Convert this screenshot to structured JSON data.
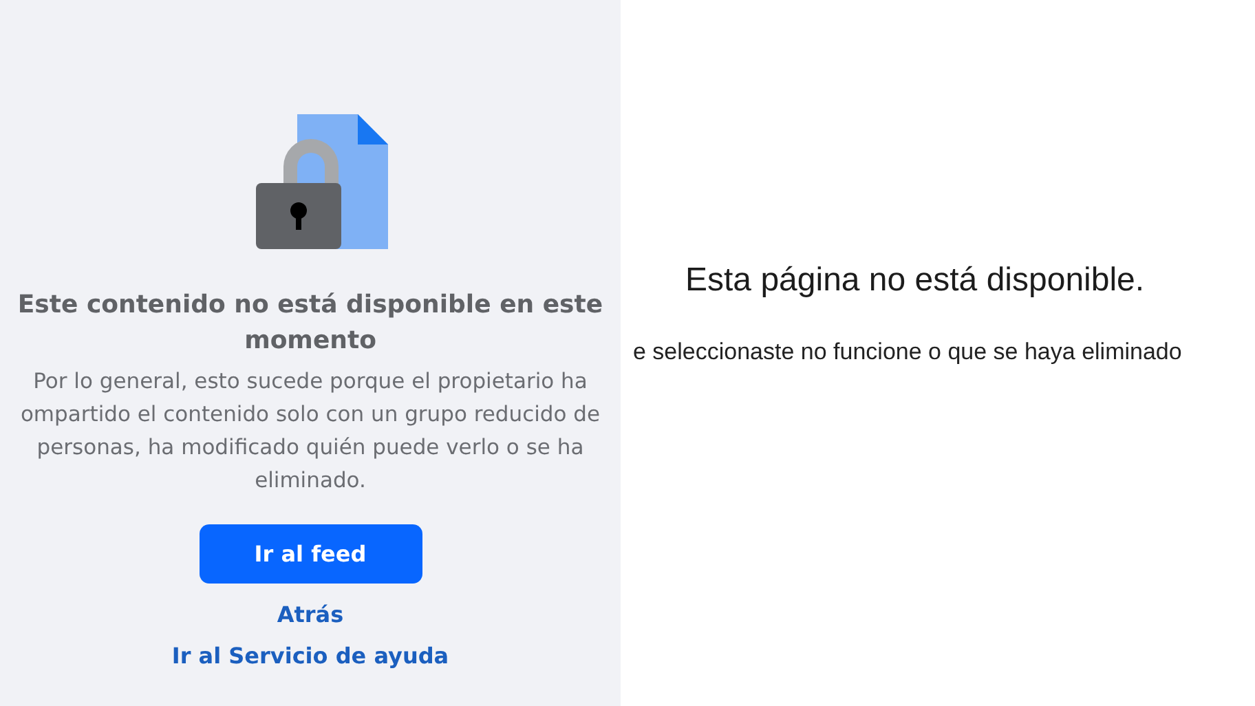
{
  "left_page": {
    "heading": "Este contenido no está disponible en este momento",
    "paragraph_lines": [
      "Por lo general, esto sucede porque el propietario ha",
      "ompartido el contenido solo con un grupo reducido de",
      "personas, ha modificado quién puede verlo o se ha",
      "eliminado."
    ],
    "button": "Ir al feed",
    "links": [
      "Atrás",
      "Ir al Servicio de ayuda"
    ]
  },
  "right_page": {
    "heading": "Esta página no está disponible.",
    "message": "e seleccionaste no funcione o que se haya eliminado"
  }
}
